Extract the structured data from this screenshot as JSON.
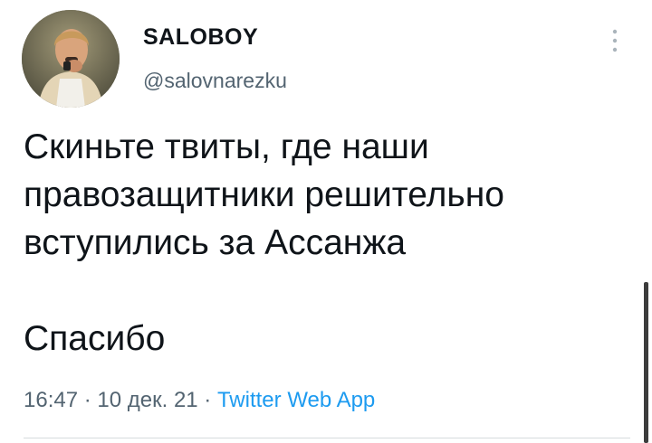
{
  "author": {
    "display_name": "SALOBOY",
    "handle": "@salovnarezku",
    "avatar_icon": "profile-photo"
  },
  "tweet": {
    "lines": [
      "Скиньте твиты, где наши",
      "правозащитники решительно",
      "вступились за Ассанжа"
    ],
    "closing": "Спасибо"
  },
  "meta": {
    "time": "16:47",
    "separator": " · ",
    "date": "10 дек. 21",
    "source": "Twitter Web App"
  },
  "colors": {
    "text": "#0f1419",
    "secondary": "#536471",
    "link": "#1d9bf0"
  }
}
